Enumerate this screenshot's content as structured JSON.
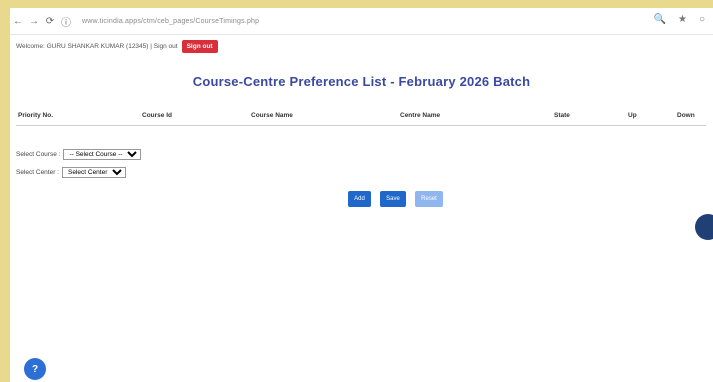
{
  "browser": {
    "url": "www.ticindia.apps/ctm/ceb_pages/CourseTimings.php",
    "nav_back": "←",
    "nav_forward": "→",
    "nav_reload": "⟳",
    "site_info": "ⓘ",
    "zoom_icon": "🔍",
    "extension_icon": "★",
    "profile_icon": "○"
  },
  "header": {
    "welcome_text": "Welcome: GURU SHANKAR KUMAR (12345) | Sign out",
    "signout_label": "Sign out"
  },
  "page": {
    "title": "Course-Centre Preference List - February 2026 Batch"
  },
  "table": {
    "columns": [
      "Priority No.",
      "Course Id",
      "Course Name",
      "Centre Name",
      "State",
      "Up",
      "Down"
    ]
  },
  "form": {
    "course_label": "Select Course :",
    "course_selected": "-- Select Course --",
    "centre_label": "Select Center :",
    "centre_selected": "Select Center"
  },
  "buttons": {
    "add": "Add",
    "save": "Save",
    "reset": "Reset"
  },
  "fab": {
    "help": "?"
  },
  "colors": {
    "background": "#e9d98f",
    "title": "#3a4aa0",
    "signout": "#d92f3a",
    "button_primary": "#1f67c9",
    "button_disabled": "#8fb6ef"
  }
}
